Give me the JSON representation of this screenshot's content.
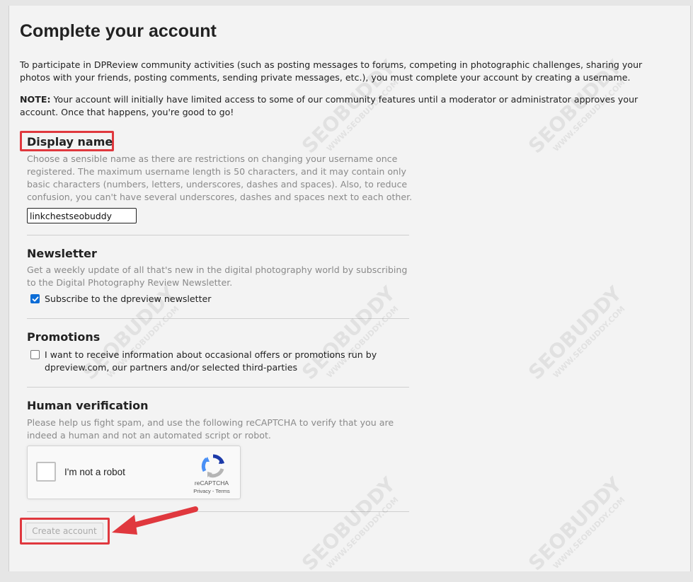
{
  "page": {
    "title": "Complete your account",
    "intro": "To participate in DPReview community activities (such as posting messages to forums, competing in photographic challenges, sharing your photos with your friends, posting comments, sending private messages, etc.), you must complete your account by creating a username.",
    "note_label": "NOTE:",
    "note_text": " Your account will initially have limited access to some of our community features until a moderator or administrator approves your account. Once that happens, you're good to go!"
  },
  "display_name": {
    "title": "Display name",
    "description": "Choose a sensible name as there are restrictions on changing your username once registered. The maximum username length is 50 characters, and it may contain only basic characters (numbers, letters, underscores, dashes and spaces). Also, to reduce confusion, you can't have several underscores, dashes and spaces next to each other.",
    "value": "linkchestseobuddy"
  },
  "newsletter": {
    "title": "Newsletter",
    "description": "Get a weekly update of all that's new in the digital photography world by subscribing to the Digital Photography Review Newsletter.",
    "checkbox_label": "Subscribe to the dpreview newsletter",
    "checked": true
  },
  "promotions": {
    "title": "Promotions",
    "checkbox_label": "I want to receive information about occasional offers or promotions run by dpreview.com, our partners and/or selected third-parties",
    "checked": false
  },
  "verification": {
    "title": "Human verification",
    "description": "Please help us fight spam, and use the following reCAPTCHA to verify that you are indeed a human and not an automated script or robot.",
    "recaptcha_label": "I'm not a robot",
    "recaptcha_brand": "reCAPTCHA",
    "recaptcha_privacy": "Privacy",
    "recaptcha_sep": " - ",
    "recaptcha_terms": "Terms"
  },
  "actions": {
    "create_label": "Create account"
  },
  "watermark": {
    "brand": "SEOBUDDY",
    "site": "WWW.SEOBUDDY.COM"
  },
  "colors": {
    "highlight": "#e0383e",
    "checkbox_checked": "#0b6cd6"
  }
}
